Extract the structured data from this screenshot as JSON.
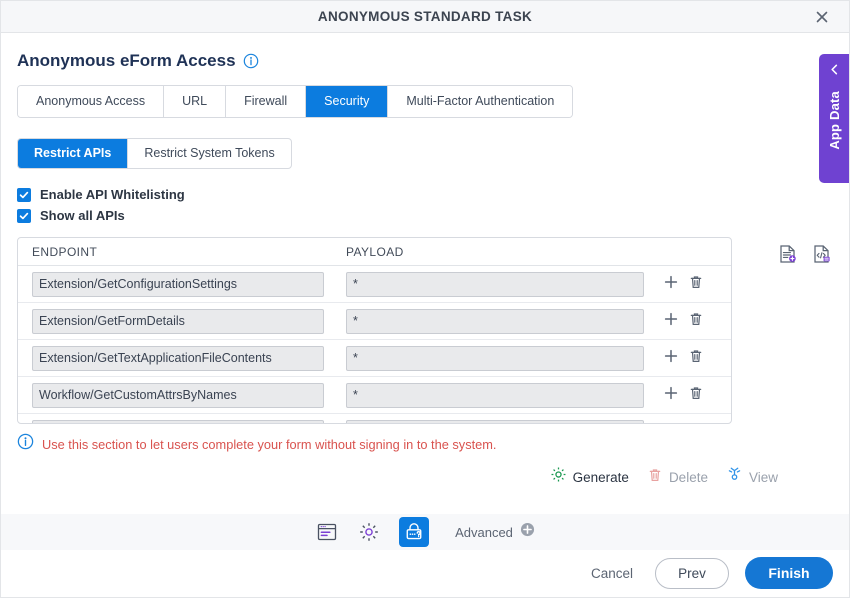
{
  "window": {
    "title": "ANONYMOUS STANDARD TASK",
    "close_icon": "close-icon"
  },
  "page": {
    "heading": "Anonymous eForm Access",
    "heading_info_icon": "info-circle-icon"
  },
  "tabs": [
    {
      "label": "Anonymous Access",
      "active": false
    },
    {
      "label": "URL",
      "active": false
    },
    {
      "label": "Firewall",
      "active": false
    },
    {
      "label": "Security",
      "active": true
    },
    {
      "label": "Multi-Factor Authentication",
      "active": false
    }
  ],
  "subtabs": [
    {
      "label": "Restrict APIs",
      "active": true
    },
    {
      "label": "Restrict System Tokens",
      "active": false
    }
  ],
  "checkboxes": [
    {
      "label": "Enable API Whitelisting",
      "checked": true
    },
    {
      "label": "Show all APIs",
      "checked": true
    }
  ],
  "table_tools": [
    {
      "icon": "import-document-icon"
    },
    {
      "icon": "export-code-document-icon"
    }
  ],
  "table": {
    "columns": [
      "ENDPOINT",
      "PAYLOAD"
    ],
    "rows": [
      {
        "endpoint": "Extension/GetConfigurationSettings",
        "payload": "*"
      },
      {
        "endpoint": "Extension/GetFormDetails",
        "payload": "*"
      },
      {
        "endpoint": "Extension/GetTextApplicationFileContents",
        "payload": "*"
      },
      {
        "endpoint": "Workflow/GetCustomAttrsByNames",
        "payload": "*"
      },
      {
        "endpoint": "",
        "payload": ""
      }
    ],
    "row_actions": {
      "add_icon": "plus-icon",
      "delete_icon": "trash-icon"
    }
  },
  "note": {
    "icon": "info-circle-icon",
    "text": "Use this section to let users complete your form without signing in to the system."
  },
  "actions": [
    {
      "label": "Generate",
      "icon": "gear-icon",
      "enabled": true
    },
    {
      "label": "Delete",
      "icon": "trash-icon",
      "enabled": false
    },
    {
      "label": "View",
      "icon": "view-key-icon",
      "enabled": false
    }
  ],
  "toolbar": {
    "items": [
      {
        "icon": "form-window-icon",
        "selected": false
      },
      {
        "icon": "gear-icon",
        "selected": false
      },
      {
        "icon": "lock-question-icon",
        "selected": true
      }
    ],
    "advanced_label": "Advanced",
    "advanced_icon": "plus-circle-icon"
  },
  "footer": {
    "cancel_label": "Cancel",
    "prev_label": "Prev",
    "finish_label": "Finish"
  },
  "app_data_panel": {
    "label": "App Data",
    "collapse_icon": "chevron-left-icon"
  },
  "colors": {
    "accent_blue": "#0c7cdf",
    "primary_blue": "#1577d4",
    "purple": "#6f42d1",
    "note_red": "#d9534f",
    "green": "#1a9850",
    "title_navy": "#1f3256"
  }
}
